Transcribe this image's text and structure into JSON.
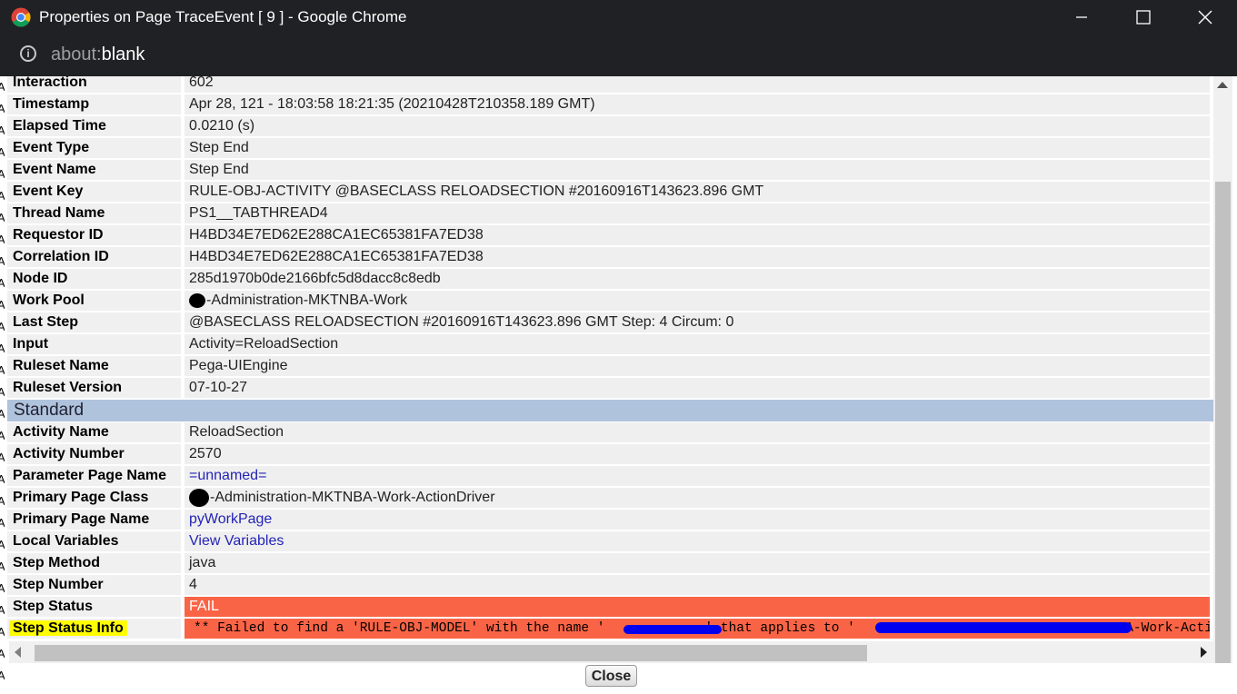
{
  "window": {
    "title": "Properties on Page TraceEvent [ 9 ] - Google Chrome",
    "url_scheme": "about:",
    "url_host": "blank"
  },
  "properties": [
    {
      "label": "Interaction",
      "value": "602"
    },
    {
      "label": "Timestamp",
      "value": "Apr 28, 121 - 18:03:58 18:21:35  (20210428T210358.189 GMT)"
    },
    {
      "label": "Elapsed Time",
      "value": "0.0210 (s)"
    },
    {
      "label": "Event Type",
      "value": "Step End"
    },
    {
      "label": "Event Name",
      "value": "Step End"
    },
    {
      "label": "Event Key",
      "value": "RULE-OBJ-ACTIVITY @BASECLASS RELOADSECTION #20160916T143623.896 GMT"
    },
    {
      "label": "Thread Name",
      "value": "PS1__TABTHREAD4"
    },
    {
      "label": "Requestor ID",
      "value": "H4BD34E7ED62E288CA1EC65381FA7ED38"
    },
    {
      "label": "Correlation ID",
      "value": "H4BD34E7ED62E288CA1EC65381FA7ED38"
    },
    {
      "label": "Node ID",
      "value": "285d1970b0de2166bfc5d8dacc8c8edb"
    },
    {
      "label": "Work Pool",
      "value": "-Administration-MKTNBA-Work"
    },
    {
      "label": "Last Step",
      "value": "@BASECLASS RELOADSECTION #20160916T143623.896 GMT Step: 4 Circum: 0"
    },
    {
      "label": "Input",
      "value": "Activity=ReloadSection"
    },
    {
      "label": "Ruleset Name",
      "value": "Pega-UIEngine"
    },
    {
      "label": "Ruleset Version",
      "value": "07-10-27"
    }
  ],
  "section_title": "Standard",
  "standard": [
    {
      "label": "Activity Name",
      "value": "ReloadSection"
    },
    {
      "label": "Activity Number",
      "value": "2570"
    },
    {
      "label": "Parameter Page Name",
      "value": "=unnamed="
    },
    {
      "label": "Primary Page Class",
      "value": "-Administration-MKTNBA-Work-ActionDriver"
    },
    {
      "label": "Primary Page Name",
      "value": "pyWorkPage"
    },
    {
      "label": "Local Variables",
      "value": "View Variables"
    },
    {
      "label": "Step Method",
      "value": "java"
    },
    {
      "label": "Step Number",
      "value": "4"
    },
    {
      "label": "Step Status",
      "value": "FAIL"
    },
    {
      "label": "Step Status Info",
      "value": "** Failed to find a 'RULE-OBJ-MODEL' with the name '",
      "value_mid": "' that applies to '",
      "value_end": "NBA-Work-ActionDrive"
    }
  ],
  "buttons": {
    "close": "Close"
  },
  "colors": {
    "fail": "#fa6446",
    "section": "#b0c3dc",
    "link": "#2323b7",
    "highlight": "#fffd00"
  }
}
